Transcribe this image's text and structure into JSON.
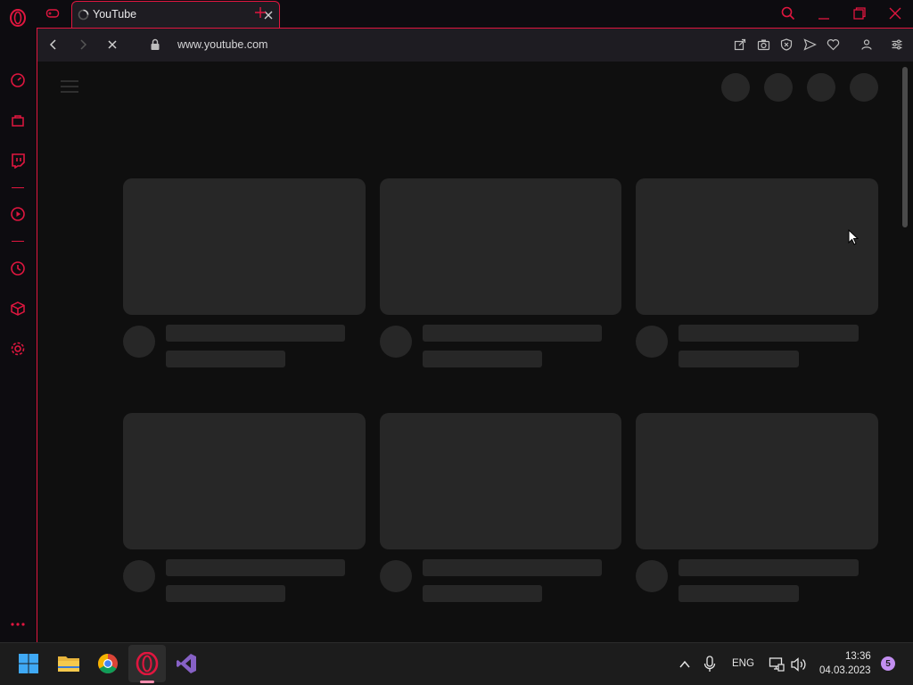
{
  "browser": {
    "tab": {
      "title": "YouTube"
    },
    "address": {
      "url": "www.youtube.com"
    }
  },
  "taskbar": {
    "language": "ENG",
    "time": "13:36",
    "date": "04.03.2023",
    "notification_count": "5"
  },
  "colors": {
    "accent": "#e0163f",
    "skeleton": "#272727",
    "background": "#0f0f0f"
  }
}
